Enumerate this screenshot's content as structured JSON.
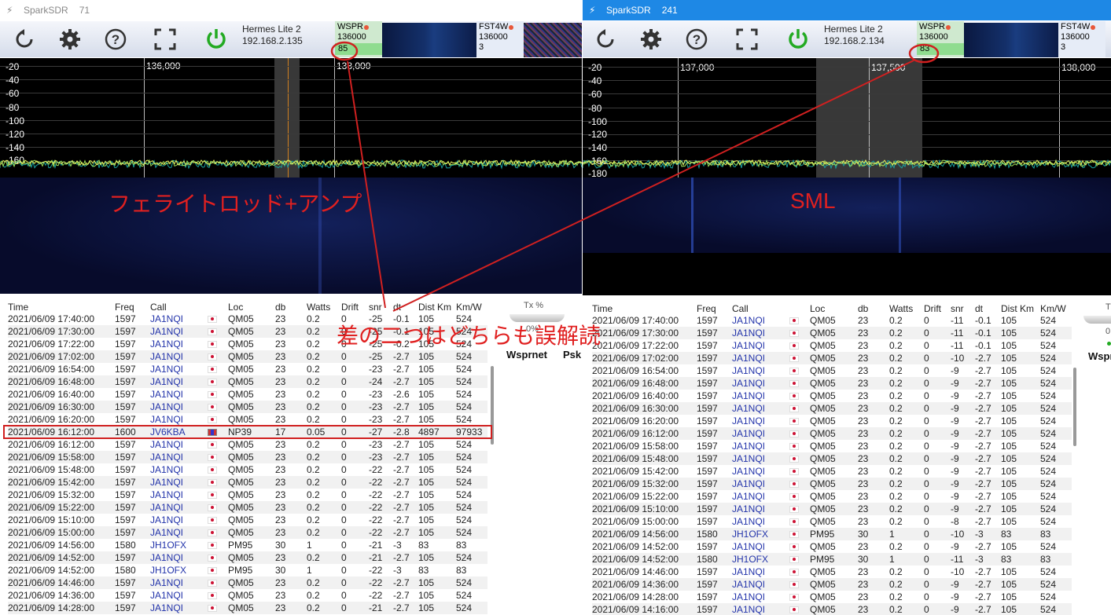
{
  "windows": [
    {
      "id": "left",
      "title": "SparkSDR",
      "instance": "71",
      "radio": {
        "name": "Hermes Lite 2",
        "ip": "192.168.2.135"
      },
      "modes": [
        {
          "name": "WSPR",
          "freq": "136000",
          "count": "85"
        },
        {
          "name": "FST4W",
          "freq": "136000",
          "count": "3"
        }
      ],
      "spectrum": {
        "db_labels": [
          "-20",
          "-40",
          "-60",
          "-80",
          "-100",
          "-120",
          "-140",
          "-160"
        ],
        "freq_labels": [
          "136,000",
          "138,000"
        ]
      },
      "overlay_label": "フェライトロッド+アンプ",
      "side": {
        "tx_label": "Tx %",
        "tx_value": "0%",
        "tab1": "Wsprnet",
        "tab2": "Psk"
      },
      "columns": [
        "Time",
        "Freq",
        "Call",
        "",
        "Loc",
        "db",
        "Watts",
        "Drift",
        "snr",
        "dt",
        "Dist Km",
        "Km/W"
      ],
      "rows": [
        [
          "2021/06/09 17:40:00",
          "1597",
          "JA1NQI",
          "QM05",
          "23",
          "0.2",
          "0",
          "-25",
          "-0.1",
          "105",
          "524"
        ],
        [
          "2021/06/09 17:30:00",
          "1597",
          "JA1NQI",
          "QM05",
          "23",
          "0.2",
          "0",
          "-25",
          "-0.1",
          "105",
          "524"
        ],
        [
          "2021/06/09 17:22:00",
          "1597",
          "JA1NQI",
          "QM05",
          "23",
          "0.2",
          "0",
          "-25",
          "-0.2",
          "105",
          "524"
        ],
        [
          "2021/06/09 17:02:00",
          "1597",
          "JA1NQI",
          "QM05",
          "23",
          "0.2",
          "0",
          "-25",
          "-2.7",
          "105",
          "524"
        ],
        [
          "2021/06/09 16:54:00",
          "1597",
          "JA1NQI",
          "QM05",
          "23",
          "0.2",
          "0",
          "-23",
          "-2.7",
          "105",
          "524"
        ],
        [
          "2021/06/09 16:48:00",
          "1597",
          "JA1NQI",
          "QM05",
          "23",
          "0.2",
          "0",
          "-24",
          "-2.7",
          "105",
          "524"
        ],
        [
          "2021/06/09 16:40:00",
          "1597",
          "JA1NQI",
          "QM05",
          "23",
          "0.2",
          "0",
          "-23",
          "-2.6",
          "105",
          "524"
        ],
        [
          "2021/06/09 16:30:00",
          "1597",
          "JA1NQI",
          "QM05",
          "23",
          "0.2",
          "0",
          "-23",
          "-2.7",
          "105",
          "524"
        ],
        [
          "2021/06/09 16:20:00",
          "1597",
          "JA1NQI",
          "QM05",
          "23",
          "0.2",
          "0",
          "-23",
          "-2.7",
          "105",
          "524"
        ],
        [
          "2021/06/09 16:12:00",
          "1600",
          "JV6KBA",
          "NP39",
          "17",
          "0.05",
          "0",
          "-27",
          "-2.8",
          "4897",
          "97933"
        ],
        [
          "2021/06/09 16:12:00",
          "1597",
          "JA1NQI",
          "QM05",
          "23",
          "0.2",
          "0",
          "-23",
          "-2.7",
          "105",
          "524"
        ],
        [
          "2021/06/09 15:58:00",
          "1597",
          "JA1NQI",
          "QM05",
          "23",
          "0.2",
          "0",
          "-23",
          "-2.7",
          "105",
          "524"
        ],
        [
          "2021/06/09 15:48:00",
          "1597",
          "JA1NQI",
          "QM05",
          "23",
          "0.2",
          "0",
          "-22",
          "-2.7",
          "105",
          "524"
        ],
        [
          "2021/06/09 15:42:00",
          "1597",
          "JA1NQI",
          "QM05",
          "23",
          "0.2",
          "0",
          "-22",
          "-2.7",
          "105",
          "524"
        ],
        [
          "2021/06/09 15:32:00",
          "1597",
          "JA1NQI",
          "QM05",
          "23",
          "0.2",
          "0",
          "-22",
          "-2.7",
          "105",
          "524"
        ],
        [
          "2021/06/09 15:22:00",
          "1597",
          "JA1NQI",
          "QM05",
          "23",
          "0.2",
          "0",
          "-22",
          "-2.7",
          "105",
          "524"
        ],
        [
          "2021/06/09 15:10:00",
          "1597",
          "JA1NQI",
          "QM05",
          "23",
          "0.2",
          "0",
          "-22",
          "-2.7",
          "105",
          "524"
        ],
        [
          "2021/06/09 15:00:00",
          "1597",
          "JA1NQI",
          "QM05",
          "23",
          "0.2",
          "0",
          "-22",
          "-2.7",
          "105",
          "524"
        ],
        [
          "2021/06/09 14:56:00",
          "1580",
          "JH1OFX",
          "PM95",
          "30",
          "1",
          "0",
          "-21",
          "-3",
          "83",
          "83"
        ],
        [
          "2021/06/09 14:52:00",
          "1597",
          "JA1NQI",
          "QM05",
          "23",
          "0.2",
          "0",
          "-21",
          "-2.7",
          "105",
          "524"
        ],
        [
          "2021/06/09 14:52:00",
          "1580",
          "JH1OFX",
          "PM95",
          "30",
          "1",
          "0",
          "-22",
          "-3",
          "83",
          "83"
        ],
        [
          "2021/06/09 14:46:00",
          "1597",
          "JA1NQI",
          "QM05",
          "23",
          "0.2",
          "0",
          "-22",
          "-2.7",
          "105",
          "524"
        ],
        [
          "2021/06/09 14:36:00",
          "1597",
          "JA1NQI",
          "QM05",
          "23",
          "0.2",
          "0",
          "-22",
          "-2.7",
          "105",
          "524"
        ],
        [
          "2021/06/09 14:28:00",
          "1597",
          "JA1NQI",
          "QM05",
          "23",
          "0.2",
          "0",
          "-21",
          "-2.7",
          "105",
          "524"
        ]
      ]
    },
    {
      "id": "right",
      "title": "SparkSDR",
      "instance": "241",
      "radio": {
        "name": "Hermes Lite 2",
        "ip": "192.168.2.134"
      },
      "modes": [
        {
          "name": "WSPR",
          "freq": "136000",
          "count": "83"
        },
        {
          "name": "FST4W",
          "freq": "136000",
          "count": "3"
        }
      ],
      "spectrum": {
        "db_labels": [
          "-20",
          "-40",
          "-60",
          "-80",
          "-100",
          "-120",
          "-140",
          "-160",
          "-180"
        ],
        "freq_labels": [
          "137,000",
          "137,500",
          "138,000"
        ]
      },
      "overlay_label": "SML",
      "side": {
        "tx_label": "T",
        "tx_value": "0",
        "tab1": "Wspr",
        "tab2": ""
      },
      "columns": [
        "Time",
        "Freq",
        "Call",
        "",
        "Loc",
        "db",
        "Watts",
        "Drift",
        "snr",
        "dt",
        "Dist Km",
        "Km/W"
      ],
      "rows": [
        [
          "2021/06/09 17:40:00",
          "1597",
          "JA1NQI",
          "QM05",
          "23",
          "0.2",
          "0",
          "-11",
          "-0.1",
          "105",
          "524"
        ],
        [
          "2021/06/09 17:30:00",
          "1597",
          "JA1NQI",
          "QM05",
          "23",
          "0.2",
          "0",
          "-11",
          "-0.1",
          "105",
          "524"
        ],
        [
          "2021/06/09 17:22:00",
          "1597",
          "JA1NQI",
          "QM05",
          "23",
          "0.2",
          "0",
          "-11",
          "-0.1",
          "105",
          "524"
        ],
        [
          "2021/06/09 17:02:00",
          "1597",
          "JA1NQI",
          "QM05",
          "23",
          "0.2",
          "0",
          "-10",
          "-2.7",
          "105",
          "524"
        ],
        [
          "2021/06/09 16:54:00",
          "1597",
          "JA1NQI",
          "QM05",
          "23",
          "0.2",
          "0",
          "-9",
          "-2.7",
          "105",
          "524"
        ],
        [
          "2021/06/09 16:48:00",
          "1597",
          "JA1NQI",
          "QM05",
          "23",
          "0.2",
          "0",
          "-9",
          "-2.7",
          "105",
          "524"
        ],
        [
          "2021/06/09 16:40:00",
          "1597",
          "JA1NQI",
          "QM05",
          "23",
          "0.2",
          "0",
          "-9",
          "-2.7",
          "105",
          "524"
        ],
        [
          "2021/06/09 16:30:00",
          "1597",
          "JA1NQI",
          "QM05",
          "23",
          "0.2",
          "0",
          "-9",
          "-2.7",
          "105",
          "524"
        ],
        [
          "2021/06/09 16:20:00",
          "1597",
          "JA1NQI",
          "QM05",
          "23",
          "0.2",
          "0",
          "-9",
          "-2.7",
          "105",
          "524"
        ],
        [
          "2021/06/09 16:12:00",
          "1597",
          "JA1NQI",
          "QM05",
          "23",
          "0.2",
          "0",
          "-9",
          "-2.7",
          "105",
          "524"
        ],
        [
          "2021/06/09 15:58:00",
          "1597",
          "JA1NQI",
          "QM05",
          "23",
          "0.2",
          "0",
          "-9",
          "-2.7",
          "105",
          "524"
        ],
        [
          "2021/06/09 15:48:00",
          "1597",
          "JA1NQI",
          "QM05",
          "23",
          "0.2",
          "0",
          "-9",
          "-2.7",
          "105",
          "524"
        ],
        [
          "2021/06/09 15:42:00",
          "1597",
          "JA1NQI",
          "QM05",
          "23",
          "0.2",
          "0",
          "-9",
          "-2.7",
          "105",
          "524"
        ],
        [
          "2021/06/09 15:32:00",
          "1597",
          "JA1NQI",
          "QM05",
          "23",
          "0.2",
          "0",
          "-9",
          "-2.7",
          "105",
          "524"
        ],
        [
          "2021/06/09 15:22:00",
          "1597",
          "JA1NQI",
          "QM05",
          "23",
          "0.2",
          "0",
          "-9",
          "-2.7",
          "105",
          "524"
        ],
        [
          "2021/06/09 15:10:00",
          "1597",
          "JA1NQI",
          "QM05",
          "23",
          "0.2",
          "0",
          "-9",
          "-2.7",
          "105",
          "524"
        ],
        [
          "2021/06/09 15:00:00",
          "1597",
          "JA1NQI",
          "QM05",
          "23",
          "0.2",
          "0",
          "-8",
          "-2.7",
          "105",
          "524"
        ],
        [
          "2021/06/09 14:56:00",
          "1580",
          "JH1OFX",
          "PM95",
          "30",
          "1",
          "0",
          "-10",
          "-3",
          "83",
          "83"
        ],
        [
          "2021/06/09 14:52:00",
          "1597",
          "JA1NQI",
          "QM05",
          "23",
          "0.2",
          "0",
          "-9",
          "-2.7",
          "105",
          "524"
        ],
        [
          "2021/06/09 14:52:00",
          "1580",
          "JH1OFX",
          "PM95",
          "30",
          "1",
          "0",
          "-11",
          "-3",
          "83",
          "83"
        ],
        [
          "2021/06/09 14:46:00",
          "1597",
          "JA1NQI",
          "QM05",
          "23",
          "0.2",
          "0",
          "-10",
          "-2.7",
          "105",
          "524"
        ],
        [
          "2021/06/09 14:36:00",
          "1597",
          "JA1NQI",
          "QM05",
          "23",
          "0.2",
          "0",
          "-9",
          "-2.7",
          "105",
          "524"
        ],
        [
          "2021/06/09 14:28:00",
          "1597",
          "JA1NQI",
          "QM05",
          "23",
          "0.2",
          "0",
          "-9",
          "-2.7",
          "105",
          "524"
        ],
        [
          "2021/06/09 14:16:00",
          "1597",
          "JA1NQI",
          "QM05",
          "23",
          "0.2",
          "0",
          "-9",
          "-2.7",
          "105",
          "524"
        ]
      ]
    }
  ],
  "annotation": {
    "text": "差の二つはどちらも誤解読",
    "color": "#e02020"
  },
  "colors": {
    "spectrum_bg": "#000000",
    "waterfall_bg": "#0a1440",
    "accent_blue": "#1e88e5",
    "power_green": "#22aa22"
  }
}
